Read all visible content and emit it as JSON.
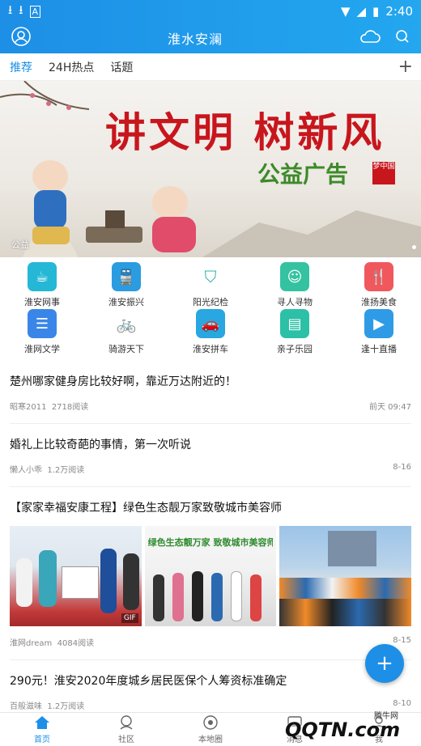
{
  "status": {
    "time": "2:40"
  },
  "header": {
    "title": "淮水安澜"
  },
  "tabs": [
    {
      "label": "推荐"
    },
    {
      "label": "24H热点"
    },
    {
      "label": "话题"
    }
  ],
  "banner": {
    "headline": "讲文明 树新风",
    "sub": "公益广告",
    "seal": "梦中国",
    "caption": "公益"
  },
  "shortcuts": [
    {
      "label": "淮安网事",
      "icon": "coffee-icon",
      "color": "#25b7d6"
    },
    {
      "label": "淮安振兴",
      "icon": "train-icon",
      "color": "#2b9cdf"
    },
    {
      "label": "阳光纪检",
      "icon": "shield-icon",
      "color": "#2bb3a3"
    },
    {
      "label": "寻人寻物",
      "icon": "person-icon",
      "color": "#35c2a1"
    },
    {
      "label": "淮扬美食",
      "icon": "fork-knife-icon",
      "color": "#f0585d"
    },
    {
      "label": "淮网文学",
      "icon": "book-icon",
      "color": "#3a86e8"
    },
    {
      "label": "骑游天下",
      "icon": "bicycle-icon",
      "color": "#41b65b"
    },
    {
      "label": "淮安拼车",
      "icon": "car-icon",
      "color": "#28a7e0"
    },
    {
      "label": "亲子乐园",
      "icon": "board-icon",
      "color": "#2cc0a7"
    },
    {
      "label": "逢十直播",
      "icon": "video-icon",
      "color": "#2f9be6"
    }
  ],
  "news": [
    {
      "title": "楚州哪家健身房比较好啊，靠近万达附近的！",
      "author": "昭寒2011",
      "reads": "2718阅读",
      "time": "前天 09:47"
    },
    {
      "title": "婚礼上比较奇葩的事情，第一次听说",
      "author": "懒人小乖",
      "reads": "1.2万阅读",
      "time": "8-16"
    },
    {
      "title": "【家家幸福安康工程】绿色生态靓万家致敬城市美容师",
      "author": "淮网dream",
      "reads": "4084阅读",
      "time": "8-15",
      "badge": "GIF",
      "img2_text": "绿色生态靓万家 致敬城市美容师"
    },
    {
      "title": "290元！淮安2020年度城乡居民医保个人筹资标准确定",
      "author": "百般滋味",
      "reads": "1.2万阅读",
      "time": "8-10"
    }
  ],
  "bottom_nav": [
    {
      "label": "首页"
    },
    {
      "label": "社区"
    },
    {
      "label": "本地圈"
    },
    {
      "label": "消息"
    },
    {
      "label": "我"
    }
  ],
  "watermark": {
    "text": "QQTN.com",
    "brand": "腾牛网"
  }
}
